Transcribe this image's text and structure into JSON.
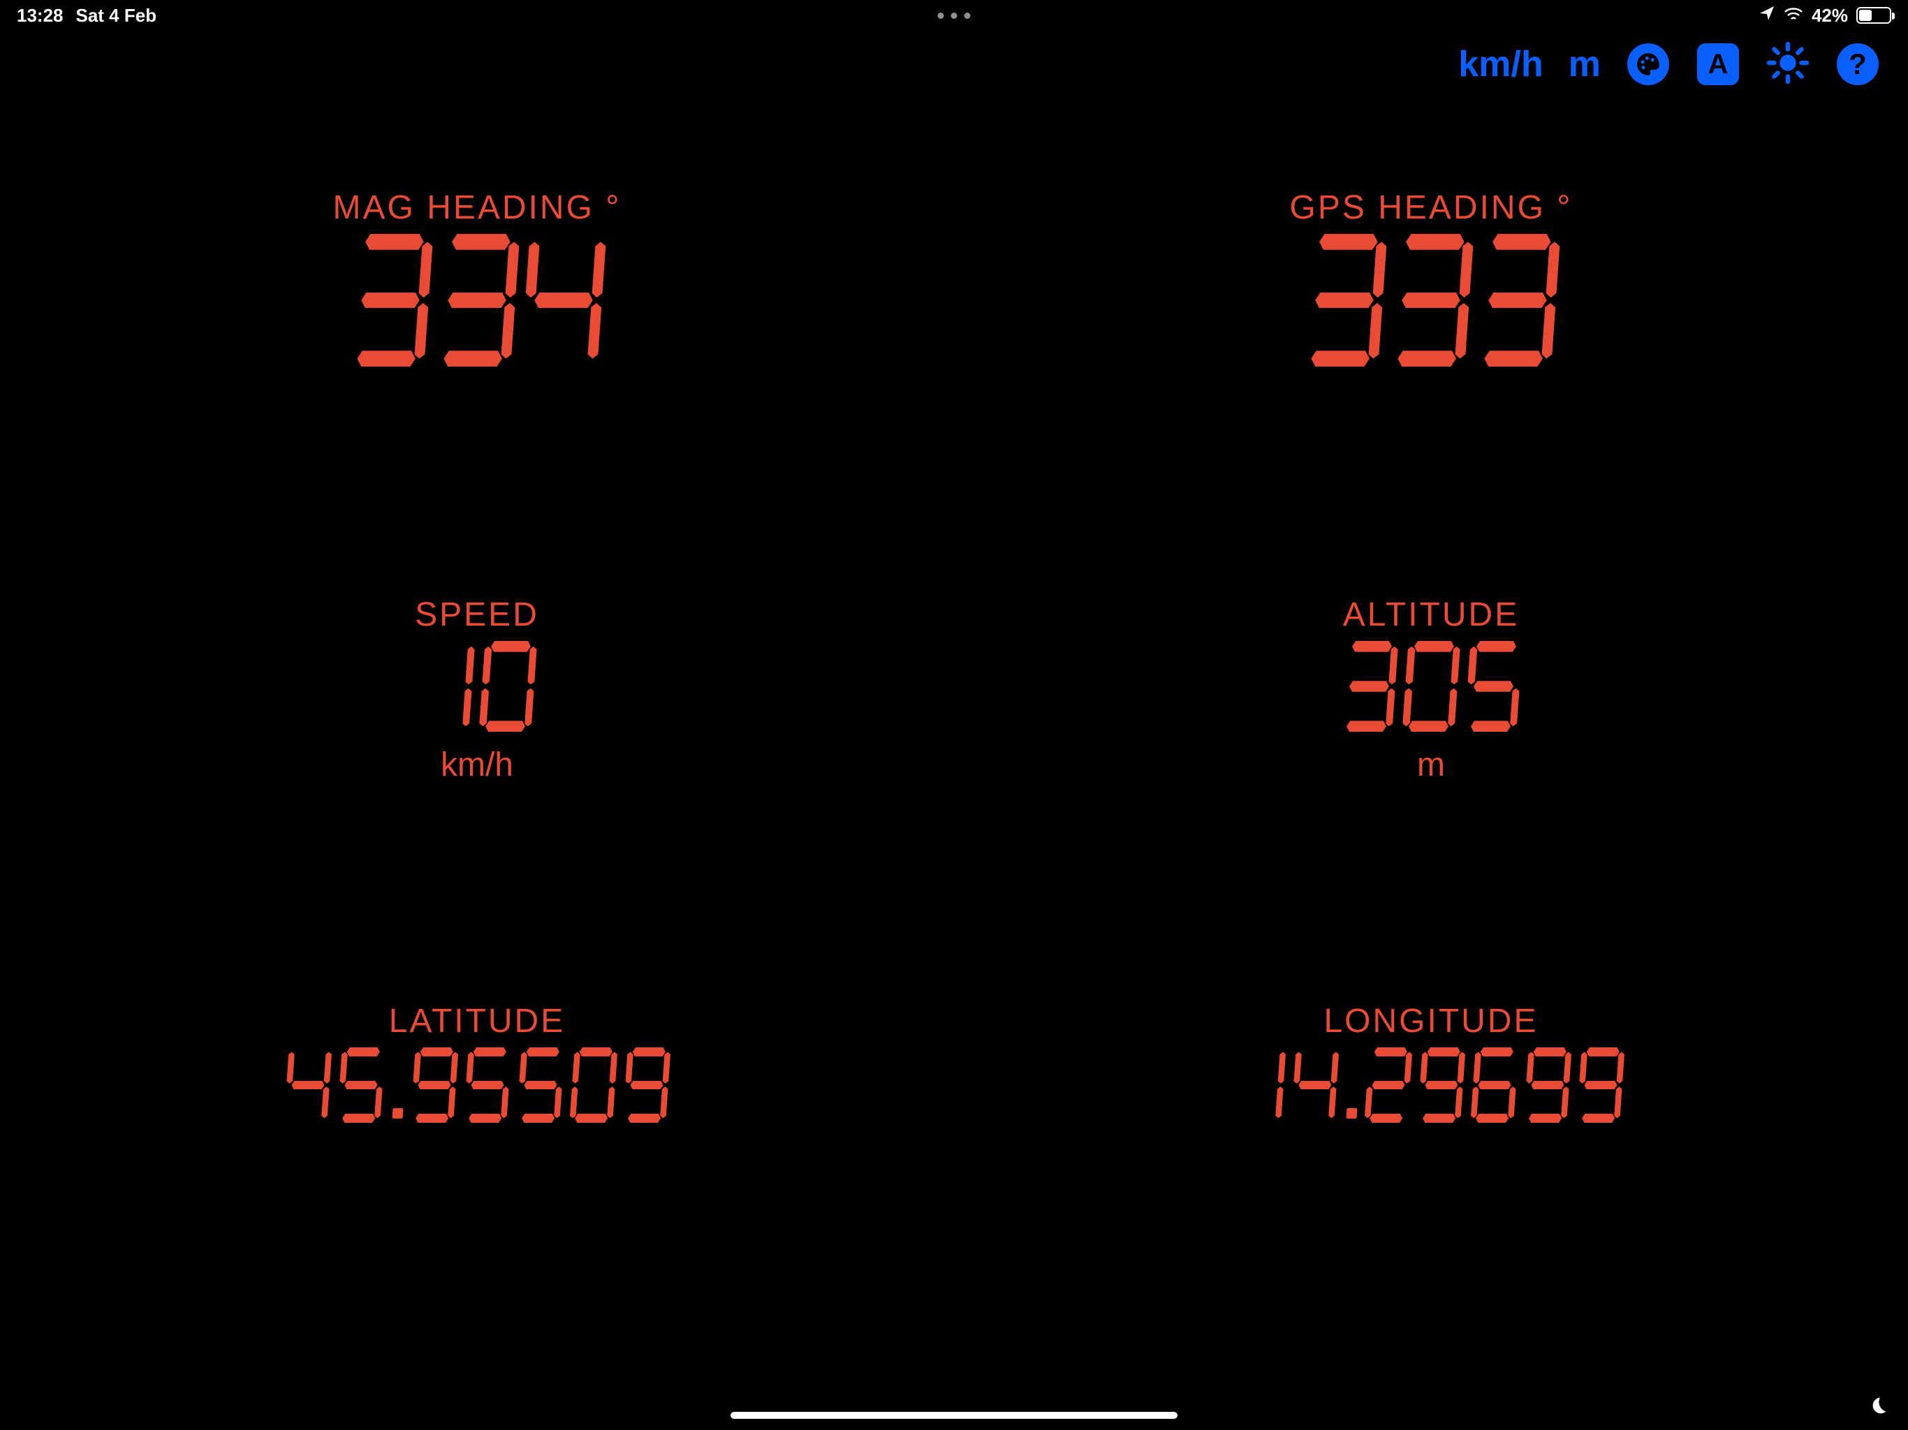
{
  "status": {
    "time": "13:28",
    "date": "Sat 4 Feb",
    "battery_pct": "42%",
    "battery_fill": 42
  },
  "toolbar": {
    "speed_unit_btn": "km/h",
    "alt_unit_btn": "m"
  },
  "readouts": {
    "mag_heading": {
      "label": "MAG HEADING °",
      "value": "334"
    },
    "gps_heading": {
      "label": "GPS HEADING °",
      "value": "333"
    },
    "speed": {
      "label": "SPEED",
      "value": "10",
      "unit": "km/h"
    },
    "altitude": {
      "label": "ALTITUDE",
      "value": "305",
      "unit": "m"
    },
    "latitude": {
      "label": "LATITUDE",
      "value": "45.95509"
    },
    "longitude": {
      "label": "LONGITUDE",
      "value": "14.29699"
    }
  },
  "colors": {
    "accent": "#e94b35",
    "ui_blue": "#0a60ff"
  }
}
